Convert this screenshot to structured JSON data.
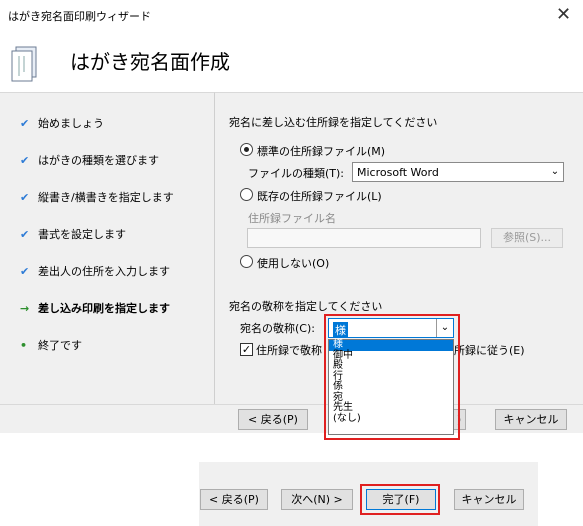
{
  "window": {
    "title": "はがき宛名面印刷ウィザード"
  },
  "banner": {
    "heading": "はがき宛名面作成"
  },
  "steps": [
    {
      "label": "始めましょう",
      "state": "done"
    },
    {
      "label": "はがきの種類を選びます",
      "state": "done"
    },
    {
      "label": "縦書き/横書きを指定します",
      "state": "done"
    },
    {
      "label": "書式を設定します",
      "state": "done"
    },
    {
      "label": "差出人の住所を入力します",
      "state": "done"
    },
    {
      "label": "差し込み印刷を指定します",
      "state": "current"
    },
    {
      "label": "終了です",
      "state": "pending"
    }
  ],
  "address": {
    "heading": "宛名に差し込む住所録を指定してください",
    "radio_standard": "標準の住所録ファイル(M)",
    "file_type_label": "ファイルの種類(T):",
    "file_type_value": "Microsoft Word",
    "radio_existing": "既存の住所録ファイル(L)",
    "file_name_label": "住所録ファイル名",
    "browse_button": "参照(S)...",
    "radio_none": "使用しない(O)"
  },
  "honorific": {
    "heading": "宛名の敬称を指定してください",
    "label": "宛名の敬称(C):",
    "value": "様",
    "checkbox_left": "住所録で敬称",
    "checkbox_right": "所録に従う(E)",
    "options": [
      "様",
      "御中",
      "殿",
      "行",
      "係",
      "宛",
      "先生",
      "(なし)"
    ]
  },
  "footer": {
    "back": "< 戻る(P)",
    "next_partial": "",
    "finish_partial": ")",
    "cancel": "キャンセル"
  },
  "crop": {
    "back": "< 戻る(P)",
    "next": "次へ(N) >",
    "finish": "完了(F)",
    "cancel": "キャンセル"
  },
  "colors": {
    "highlight_border": "#e02020",
    "selection": "#0078d7",
    "check": "#2d7bd6"
  }
}
